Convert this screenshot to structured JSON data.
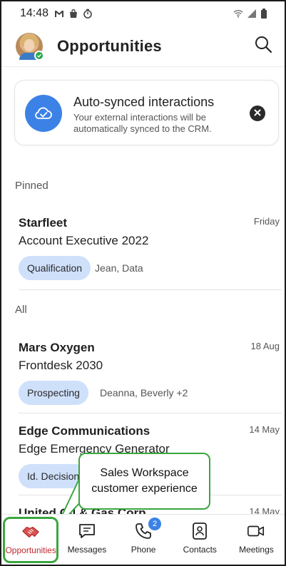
{
  "status_bar": {
    "time": "14:48",
    "left_icons": [
      "gmail-icon",
      "bag-icon",
      "timer-icon"
    ],
    "right_icons": [
      "wifi-icon",
      "signal-icon",
      "battery-icon"
    ]
  },
  "header": {
    "title": "Opportunities",
    "presence_color": "#22a84a"
  },
  "sync_banner": {
    "title": "Auto-synced interactions",
    "text": "Your external interactions will be automatically synced to the CRM.",
    "icon": "cloud-sync-icon",
    "icon_bg": "#3c82e6"
  },
  "sections": {
    "pinned_label": "Pinned",
    "all_label": "All"
  },
  "pinned": [
    {
      "name": "Starfleet",
      "subtitle": "Account Executive 2022",
      "date": "Friday",
      "stage": "Qualification",
      "people": "Jean, Data"
    }
  ],
  "all": [
    {
      "name": "Mars Oxygen",
      "subtitle": "Frontdesk 2030",
      "date": "18 Aug",
      "stage": "Prospecting",
      "people": "Deanna, Beverly +2"
    },
    {
      "name": "Edge Communications",
      "subtitle": "Edge Emergency Generator",
      "date": "14 May",
      "stage": "Id. Decision",
      "people": ""
    },
    {
      "name": "United Oil & Gas Corp",
      "subtitle": "",
      "date": "14 May",
      "stage": "",
      "people": ""
    }
  ],
  "callout": {
    "text": "Sales Workspace customer experience",
    "border_color": "#3aa63e"
  },
  "bottom_nav": {
    "items": [
      {
        "label": "Opportunities",
        "icon": "handshake-icon",
        "active": true
      },
      {
        "label": "Messages",
        "icon": "chat-icon",
        "active": false
      },
      {
        "label": "Phone",
        "icon": "phone-icon",
        "active": false,
        "badge": "2"
      },
      {
        "label": "Contacts",
        "icon": "contact-card-icon",
        "active": false
      },
      {
        "label": "Meetings",
        "icon": "video-camera-icon",
        "active": false
      }
    ],
    "active_color": "#c2272d",
    "badge_color": "#3c82e6"
  }
}
